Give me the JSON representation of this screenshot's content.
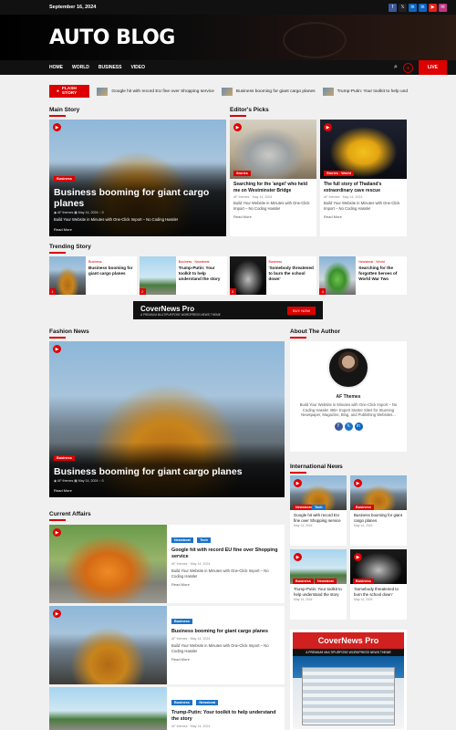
{
  "topbar": {
    "date": "September 16, 2024",
    "social": [
      "f",
      "𝕏",
      "in",
      "in",
      "▶",
      "✉"
    ],
    "social_colors": [
      "#3b5998",
      "#222",
      "#0a66c2",
      "#0a66c2",
      "#e62117",
      "#c13584"
    ]
  },
  "header": {
    "brand": "AUTO BLOG"
  },
  "nav": {
    "items": [
      "HOME",
      "WORLD",
      "BUSINESS",
      "VIDEO"
    ],
    "live": "LIVE"
  },
  "flash": {
    "label": "FLASH STORY",
    "items": [
      "Google hit with record EU fine over Shopping service",
      "Business booming for giant cargo planes",
      "Trump-Putin: Your toolkit to help und"
    ]
  },
  "main_story": {
    "section": "Main Story",
    "category": "Business",
    "title": "Business booming for giant cargo planes",
    "author": "AF themes",
    "date": "May 14, 2024",
    "comments": "0",
    "excerpt": "Build Your Website in Minutes with One-Click Import – No Coding Hassle!",
    "read_more": "Read More"
  },
  "editors_picks": {
    "section": "Editor's Picks",
    "items": [
      {
        "category": "Stories",
        "title": "Searching for the 'angel' who held me on Westminster Bridge",
        "author": "AF themes",
        "date": "May 14, 2024",
        "excerpt": "Build Your Website in Minutes with One-Click Import – No Coding Hassle!",
        "read_more": "Read More"
      },
      {
        "category": "Stories · World",
        "title": "The full story of Thailand's extraordinary cave rescue",
        "author": "AF themes",
        "date": "May 14, 2024",
        "excerpt": "Build Your Website in Minutes with One-Click Import – No Coding Hassle!",
        "read_more": "Read More"
      }
    ]
  },
  "trending": {
    "section": "Trending Story",
    "items": [
      {
        "num": "1",
        "cats": "Business",
        "title": "Business booming for giant cargo planes"
      },
      {
        "num": "2",
        "cats": "Business · Newsbeat",
        "title": "Trump-Putin: Your toolkit to help understand the story"
      },
      {
        "num": "3",
        "cats": "Business",
        "title": "'Somebody threatened to burn the school down'"
      },
      {
        "num": "4",
        "cats": "Newsbeat · World",
        "title": "Searching for the forgotten heroes of World War Two"
      }
    ]
  },
  "ad": {
    "logo": "CoverNews Pro",
    "sub": "A PREMIUM MULTIPURPOSE WORDPRESS NEWS THEME",
    "button": "BUY NOW"
  },
  "fashion": {
    "section": "Fashion News",
    "category": "Business",
    "title": "Business booming for giant cargo planes",
    "author": "AF themes",
    "date": "May 14, 2024",
    "comments": "0",
    "read_more": "Read More"
  },
  "about": {
    "section": "About The Author",
    "name": "AF Themes",
    "bio": "Build Your Website in Minutes with One-Click Import – No Coding Hassle! 365+ Expert Starter Sites for Stunning Newspaper, Magazine, Blog, and Publishing Websites..."
  },
  "international": {
    "section": "International News",
    "items": [
      {
        "cats": [
          "Newsbeat",
          "Tech"
        ],
        "title": "Google hit with record EU fine over Shopping service",
        "date": "May 14, 2024"
      },
      {
        "cats": [
          "Business"
        ],
        "title": "Business booming for giant cargo planes",
        "date": "May 14, 2024"
      },
      {
        "cats": [
          "Business",
          "Newsbeat"
        ],
        "title": "Trump-Putin: Your toolkit to help understand the story",
        "date": "May 14, 2024"
      },
      {
        "cats": [
          "Business"
        ],
        "title": "'Somebody threatened to burn the school down'",
        "date": "May 14, 2024"
      }
    ]
  },
  "right_ad": {
    "logo": "CoverNews Pro",
    "sub": "A PREMIUM MULTIPURPOSE WORDPRESS NEWS THEME"
  },
  "current_affairs": {
    "section": "Current Affairs",
    "items": [
      {
        "cats": [
          "Newsbeat",
          "Tech"
        ],
        "title": "Google hit with record EU fine over Shopping service",
        "author": "AF themes",
        "date": "May 14, 2024",
        "excerpt": "Build Your Website in Minutes with One-Click Import – No Coding Hassle!",
        "read_more": "Read More"
      },
      {
        "cats": [
          "Business"
        ],
        "title": "Business booming for giant cargo planes",
        "author": "AF themes",
        "date": "May 14, 2024",
        "excerpt": "Build Your Website in Minutes with One-Click Import – No Coding Hassle!",
        "read_more": "Read More"
      },
      {
        "cats": [
          "Business",
          "Newsbeat"
        ],
        "title": "Trump-Putin: Your toolkit to help understand the story",
        "author": "AF themes",
        "date": "May 14, 2024"
      }
    ]
  }
}
